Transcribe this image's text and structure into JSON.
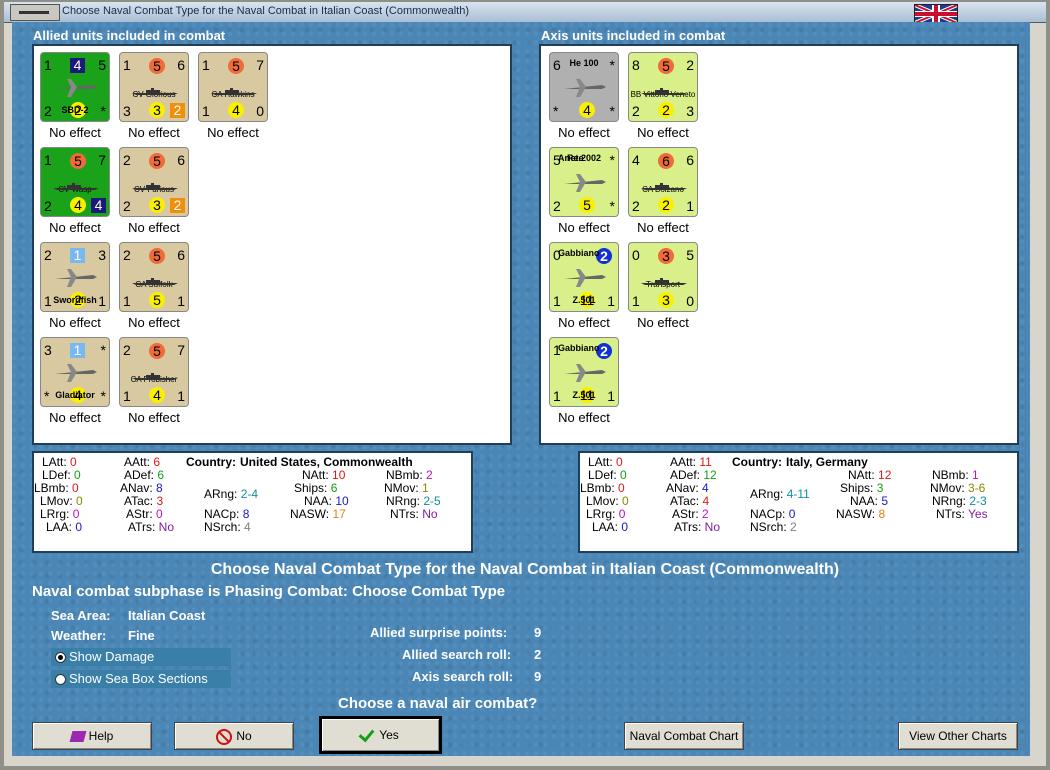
{
  "window": {
    "title": "Choose Naval Combat Type for the Naval Combat in Italian Coast (Commonwealth)"
  },
  "allied": {
    "header": "Allied units included in combat",
    "units": [
      {
        "name": "SBD-2",
        "type": "plane",
        "color": "green",
        "tl": "1",
        "tc": "4",
        "tr": "5",
        "bl": "2",
        "bc": "2",
        "br": "*",
        "effect": "No effect"
      },
      {
        "name": "CV Glorious",
        "type": "ship",
        "color": "tan",
        "tl": "1",
        "tc": "5",
        "tr": "6",
        "bl": "3",
        "bc": "3",
        "br": "2",
        "effect": "No effect"
      },
      {
        "name": "CA Hawkins",
        "type": "ship",
        "color": "tan",
        "tl": "1",
        "tc": "5",
        "tr": "7",
        "bl": "1",
        "bc": "4",
        "br": "0",
        "effect": "No effect"
      },
      {
        "name": "CV Wasp",
        "type": "ship",
        "color": "green",
        "tl": "1",
        "tc": "5",
        "tr": "7",
        "bl": "2",
        "bc": "4",
        "br": "4",
        "effect": "No effect"
      },
      {
        "name": "CV Furious",
        "type": "ship",
        "color": "tan",
        "tl": "2",
        "tc": "5",
        "tr": "6",
        "bl": "2",
        "bc": "3",
        "br": "2",
        "effect": "No effect"
      },
      {
        "name": "Swordfish",
        "type": "plane",
        "color": "tan",
        "tl": "2",
        "tc": "1",
        "tr": "3",
        "bl": "1",
        "bc": "2",
        "br": "1",
        "effect": "No effect"
      },
      {
        "name": "CA Suffolk",
        "type": "ship",
        "color": "tan",
        "tl": "2",
        "tc": "5",
        "tr": "6",
        "bl": "1",
        "bc": "5",
        "br": "1",
        "effect": "No effect"
      },
      {
        "name": "Gladiator",
        "type": "plane",
        "color": "tan",
        "tl": "3",
        "tc": "1",
        "tr": "*",
        "bl": "*",
        "bc": "4",
        "br": "*",
        "effect": "No effect"
      },
      {
        "name": "CA Frobisher",
        "type": "ship",
        "color": "tan",
        "tl": "2",
        "tc": "5",
        "tr": "7",
        "bl": "1",
        "bc": "4",
        "br": "1",
        "effect": "No effect"
      }
    ]
  },
  "axis": {
    "header": "Axis units included in combat",
    "units": [
      {
        "name": "He 100",
        "type": "plane",
        "color": "grey",
        "tl": "6",
        "tc": "",
        "tr": "*",
        "bl": "*",
        "bc": "4",
        "br": "*",
        "effect": "No effect"
      },
      {
        "name": "BB Vittorio Veneto",
        "type": "ship",
        "color": "lime",
        "tl": "8",
        "tc": "5",
        "tr": "2",
        "bl": "2",
        "bc": "2",
        "br": "3",
        "effect": "No effect"
      },
      {
        "name": "Re.2002",
        "sub": "Ariete",
        "type": "plane",
        "color": "lime",
        "tl": "5",
        "tc": "",
        "tr": "*",
        "bl": "2",
        "bc": "5",
        "br": "*",
        "effect": "No effect"
      },
      {
        "name": "CA Bolzano",
        "type": "ship",
        "color": "lime",
        "tl": "4",
        "tc": "6",
        "tr": "6",
        "bl": "2",
        "bc": "2",
        "br": "1",
        "effect": "No effect"
      },
      {
        "name": "Z.501",
        "sub": "Gabbiano",
        "type": "plane",
        "color": "lime",
        "tl": "0",
        "tc": "2",
        "tr": "",
        "bl": "1",
        "bc": "11",
        "br": "1",
        "effect": "No effect"
      },
      {
        "name": "Transport",
        "type": "ship",
        "color": "lime",
        "tl": "0",
        "tc": "3",
        "tr": "5",
        "bl": "1",
        "bc": "3",
        "br": "0",
        "effect": "No effect"
      },
      {
        "name": "Z.501",
        "sub": "Gabbiano",
        "type": "plane",
        "color": "lime",
        "tl": "1",
        "tc": "2",
        "tr": "",
        "bl": "1",
        "bc": "11",
        "br": "1",
        "effect": "No effect"
      }
    ]
  },
  "allied_stats": {
    "country_label": "Country:",
    "country": "United States, Commonwealth",
    "LAtt": "0",
    "LDef": "0",
    "LBmb": "0",
    "LMov": "0",
    "LRrg": "0",
    "LAA": "0",
    "AAtt": "6",
    "ADef": "6",
    "ANav": "8",
    "ATac": "3",
    "AStr": "0",
    "ATrs": "No",
    "ARng": "2-4",
    "NACp": "8",
    "NSrch": "4",
    "NAtt": "10",
    "Ships": "6",
    "NAA": "10",
    "NASW": "17",
    "NBmb": "2",
    "NMov": "1",
    "NRng": "2-5",
    "NTrs": "No"
  },
  "axis_stats": {
    "country_label": "Country:",
    "country": "Italy, Germany",
    "LAtt": "0",
    "LDef": "0",
    "LBmb": "0",
    "LMov": "0",
    "LRrg": "0",
    "LAA": "0",
    "AAtt": "11",
    "ADef": "12",
    "ANav": "4",
    "ATac": "4",
    "AStr": "2",
    "ATrs": "No",
    "ARng": "4-11",
    "NACp": "0",
    "NSrch": "2",
    "NAtt": "12",
    "Ships": "3",
    "NAA": "5",
    "NASW": "8",
    "NBmb": "1",
    "NMov": "3-6",
    "NRng": "2-3",
    "NTrs": "Yes"
  },
  "main": {
    "heading": "Choose Naval Combat Type for the Naval Combat in Italian Coast (Commonwealth)",
    "subphase": "Naval combat subphase is Phasing Combat: Choose Combat Type",
    "sea_area_label": "Sea Area:",
    "sea_area": "Italian Coast",
    "weather_label": "Weather:",
    "weather": "Fine",
    "show_damage": "Show Damage",
    "show_sea_box": "Show Sea Box Sections",
    "allied_surprise": "Allied surprise points:",
    "allied_surprise_val": "9",
    "allied_search": "Allied search roll:",
    "allied_search_val": "2",
    "axis_search": "Axis search roll:",
    "axis_search_val": "9",
    "question": "Choose a naval air combat?"
  },
  "buttons": {
    "help": "Help",
    "no": "No",
    "yes": "Yes",
    "naval_chart": "Naval Combat Chart",
    "other_charts": "View Other Charts"
  }
}
